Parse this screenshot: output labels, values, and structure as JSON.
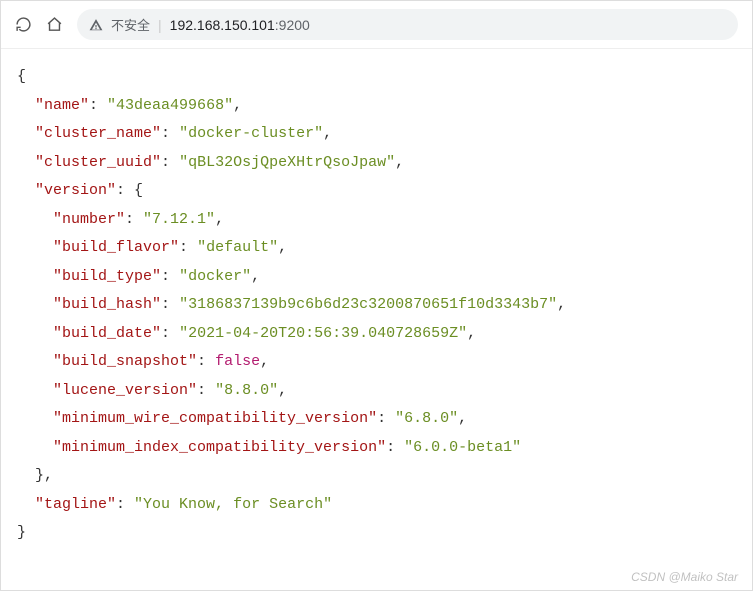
{
  "toolbar": {
    "insecure_label": "不安全",
    "divider": "|",
    "url_host": "192.168.150.101",
    "url_port": ":9200"
  },
  "json": {
    "keys": {
      "name": "\"name\"",
      "cluster_name": "\"cluster_name\"",
      "cluster_uuid": "\"cluster_uuid\"",
      "version": "\"version\"",
      "number": "\"number\"",
      "build_flavor": "\"build_flavor\"",
      "build_type": "\"build_type\"",
      "build_hash": "\"build_hash\"",
      "build_date": "\"build_date\"",
      "build_snapshot": "\"build_snapshot\"",
      "lucene_version": "\"lucene_version\"",
      "min_wire": "\"minimum_wire_compatibility_version\"",
      "min_index": "\"minimum_index_compatibility_version\"",
      "tagline": "\"tagline\""
    },
    "vals": {
      "name": "\"43deaa499668\"",
      "cluster_name": "\"docker-cluster\"",
      "cluster_uuid": "\"qBL32OsjQpeXHtrQsoJpaw\"",
      "number": "\"7.12.1\"",
      "build_flavor": "\"default\"",
      "build_type": "\"docker\"",
      "build_hash": "\"3186837139b9c6b6d23c3200870651f10d3343b7\"",
      "build_date": "\"2021-04-20T20:56:39.040728659Z\"",
      "build_snapshot": "false",
      "lucene_version": "\"8.8.0\"",
      "min_wire": "\"6.8.0\"",
      "min_index": "\"6.0.0-beta1\"",
      "tagline": "\"You Know, for Search\""
    },
    "punct": {
      "ob": "{",
      "cb": "}",
      "colon": ": ",
      "comma": ","
    }
  },
  "watermark": "CSDN @Maiko Star"
}
